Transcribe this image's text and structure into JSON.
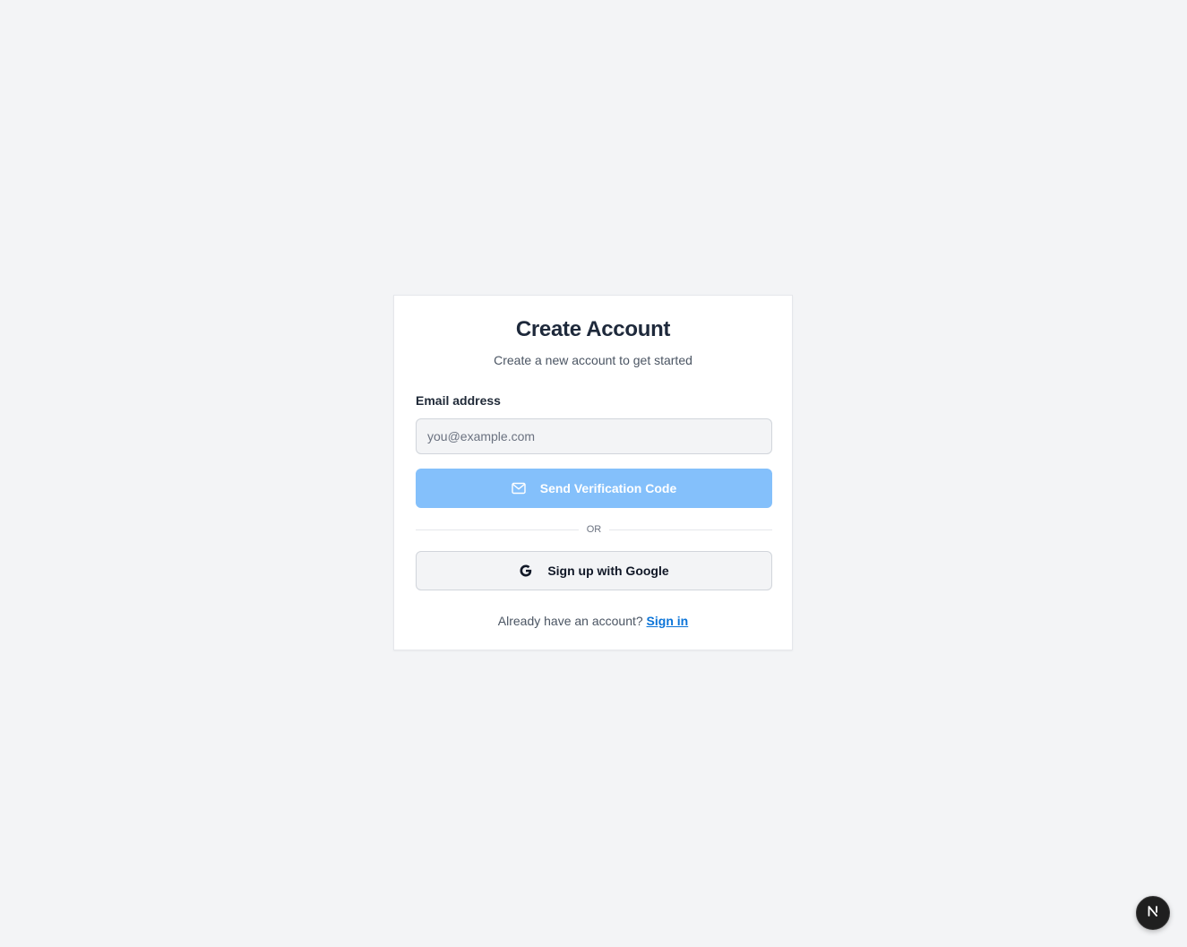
{
  "card": {
    "title": "Create Account",
    "subtitle": "Create a new account to get started"
  },
  "form": {
    "email_label": "Email address",
    "email_placeholder": "you@example.com",
    "email_value": "",
    "send_button_label": "Send Verification Code",
    "send_button_icon": "mail-icon",
    "divider_label": "OR",
    "google_button_label": "Sign up with Google",
    "google_button_icon": "google-icon"
  },
  "footer": {
    "prompt": "Already have an account?",
    "link_label": "Sign in"
  },
  "badge": {
    "icon": "nextjs-icon",
    "letter": "N"
  },
  "colors": {
    "background": "#f3f4f6",
    "primary_button": "#84c0fb",
    "link": "#0b74d8",
    "title": "#1e293b"
  }
}
